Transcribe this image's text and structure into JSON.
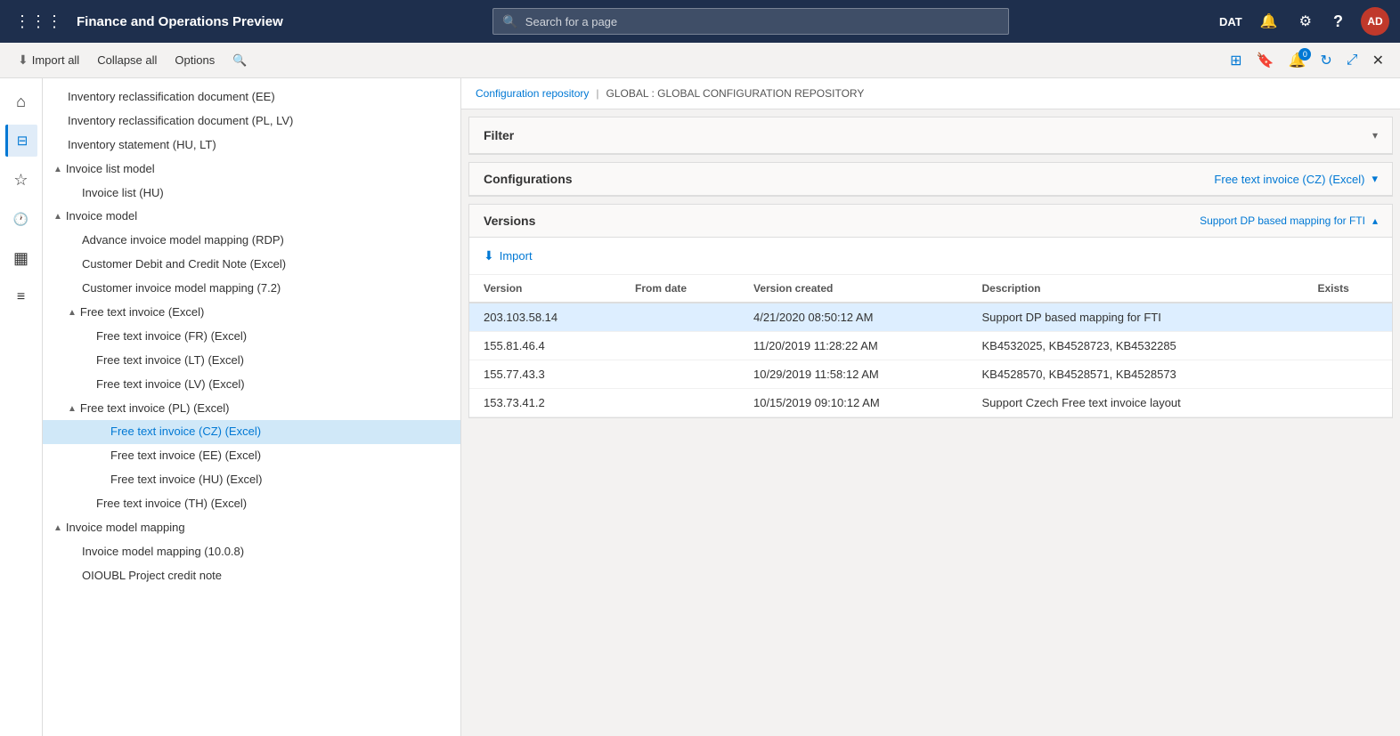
{
  "topNav": {
    "appTitle": "Finance and Operations Preview",
    "searchPlaceholder": "Search for a page",
    "userLabel": "DAT",
    "avatarInitials": "AD"
  },
  "toolbar": {
    "importAllLabel": "Import all",
    "collapseAllLabel": "Collapse all",
    "optionsLabel": "Options"
  },
  "breadcrumb": {
    "configRepo": "Configuration repository",
    "separator": "|",
    "globalRepo": "GLOBAL : GLOBAL CONFIGURATION REPOSITORY"
  },
  "filterSection": {
    "title": "Filter",
    "collapsed": true
  },
  "configurationsSection": {
    "title": "Configurations",
    "selectedConfig": "Free text invoice (CZ) (Excel)"
  },
  "versionsSection": {
    "title": "Versions",
    "rightLabel": "Support DP based mapping for FTI",
    "importButtonLabel": "Import",
    "columns": [
      "Version",
      "From date",
      "Version created",
      "Description",
      "Exists"
    ],
    "rows": [
      {
        "version": "203.103.58.14",
        "fromDate": "",
        "versionCreated": "4/21/2020 08:50:12 AM",
        "description": "Support DP based mapping for FTI",
        "exists": "",
        "selected": true
      },
      {
        "version": "155.81.46.4",
        "fromDate": "",
        "versionCreated": "11/20/2019 11:28:22 AM",
        "description": "KB4532025, KB4528723, KB4532285",
        "exists": "",
        "selected": false
      },
      {
        "version": "155.77.43.3",
        "fromDate": "",
        "versionCreated": "10/29/2019 11:58:12 AM",
        "description": "KB4528570, KB4528571, KB4528573",
        "exists": "",
        "selected": false
      },
      {
        "version": "153.73.41.2",
        "fromDate": "",
        "versionCreated": "10/15/2019 09:10:12 AM",
        "description": "Support Czech Free text invoice layout",
        "exists": "",
        "selected": false
      }
    ]
  },
  "treeItems": [
    {
      "label": "Inventory reclassification document (EE)",
      "indent": 2,
      "type": "leaf"
    },
    {
      "label": "Inventory reclassification document (PL, LV)",
      "indent": 2,
      "type": "leaf"
    },
    {
      "label": "Inventory statement (HU, LT)",
      "indent": 2,
      "type": "leaf"
    },
    {
      "label": "Invoice list model",
      "indent": 1,
      "type": "branch",
      "expanded": true
    },
    {
      "label": "Invoice list (HU)",
      "indent": 2,
      "type": "leaf"
    },
    {
      "label": "Invoice model",
      "indent": 1,
      "type": "branch",
      "expanded": true
    },
    {
      "label": "Advance invoice model mapping (RDP)",
      "indent": 2,
      "type": "leaf"
    },
    {
      "label": "Customer Debit and Credit Note (Excel)",
      "indent": 2,
      "type": "leaf"
    },
    {
      "label": "Customer invoice model mapping (7.2)",
      "indent": 2,
      "type": "leaf"
    },
    {
      "label": "Free text invoice (Excel)",
      "indent": 2,
      "type": "branch",
      "expanded": true
    },
    {
      "label": "Free text invoice (FR) (Excel)",
      "indent": 3,
      "type": "leaf"
    },
    {
      "label": "Free text invoice (LT) (Excel)",
      "indent": 3,
      "type": "leaf"
    },
    {
      "label": "Free text invoice (LV) (Excel)",
      "indent": 3,
      "type": "leaf"
    },
    {
      "label": "Free text invoice (PL) (Excel)",
      "indent": 2,
      "type": "branch",
      "expanded": true
    },
    {
      "label": "Free text invoice (CZ) (Excel)",
      "indent": 3,
      "type": "leaf",
      "selected": true
    },
    {
      "label": "Free text invoice (EE) (Excel)",
      "indent": 3,
      "type": "leaf"
    },
    {
      "label": "Free text invoice (HU) (Excel)",
      "indent": 3,
      "type": "leaf"
    },
    {
      "label": "Free text invoice (TH) (Excel)",
      "indent": 2,
      "type": "leaf"
    },
    {
      "label": "Invoice model mapping",
      "indent": 1,
      "type": "branch",
      "expanded": true
    },
    {
      "label": "Invoice model mapping (10.0.8)",
      "indent": 2,
      "type": "leaf"
    },
    {
      "label": "OIOUBL Project credit note",
      "indent": 2,
      "type": "leaf"
    }
  ],
  "sidebarIcons": [
    {
      "name": "home",
      "glyph": "⌂",
      "active": false
    },
    {
      "name": "filter",
      "glyph": "⊞",
      "active": false
    },
    {
      "name": "star",
      "glyph": "☆",
      "active": false
    },
    {
      "name": "history",
      "glyph": "🕐",
      "active": false
    },
    {
      "name": "table",
      "glyph": "▦",
      "active": false
    },
    {
      "name": "list",
      "glyph": "≡",
      "active": true
    }
  ]
}
